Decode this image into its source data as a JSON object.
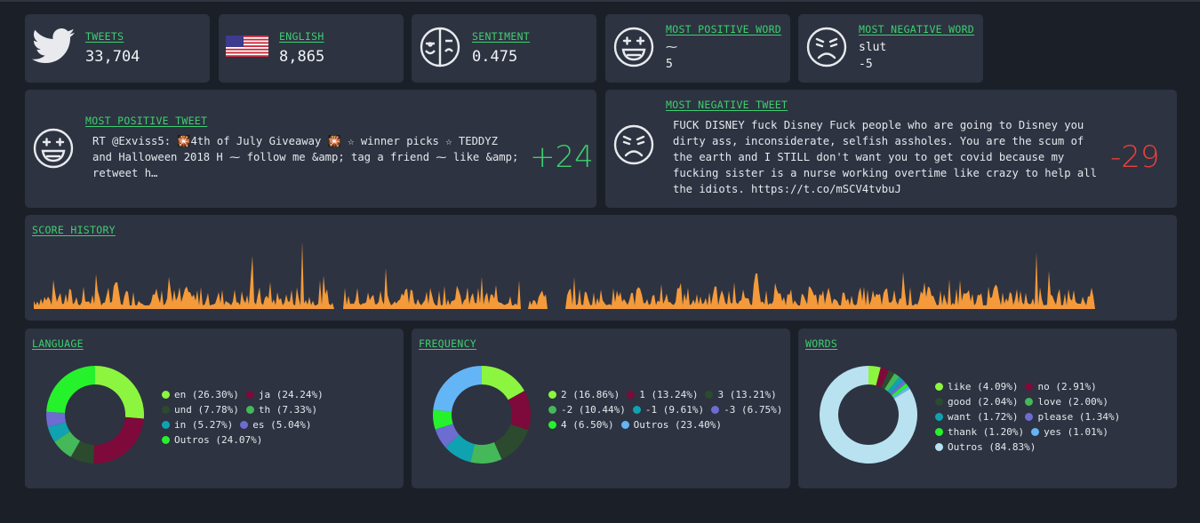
{
  "stats": {
    "tweets": {
      "label": "TWEETS",
      "value": "33,704"
    },
    "english": {
      "label": "ENGLISH",
      "value": "8,865"
    },
    "sentiment": {
      "label": "SENTIMENT",
      "value": "0.475"
    },
    "most_positive_word": {
      "label": "MOST POSITIVE WORD",
      "word": "⁓",
      "score": "5"
    },
    "most_negative_word": {
      "label": "MOST NEGATIVE WORD",
      "word": "slut",
      "score": "-5"
    }
  },
  "most_positive_tweet": {
    "label": "MOST POSITIVE TWEET",
    "lines": [
      "RT @Exviss5: 🎇4th of July Giveaway 🎇 ☆ winner picks ☆ TEDDYZ",
      "and Halloween 2018 H ⁓ follow me &amp; tag a friend ⁓ like &amp;",
      "retweet h…"
    ],
    "score": "+24",
    "score_color": "#3dcf6f"
  },
  "most_negative_tweet": {
    "label": "MOST NEGATIVE TWEET",
    "lines": [
      "FUCK DISNEY fuck Disney Fuck people who are going to Disney you",
      "dirty ass, inconsiderate, selfish assholes. You are the scum of",
      "the earth and I STILL don't want you to get covid because my",
      "fucking sister is a nurse working overtime like crazy to help all",
      "the idiots. https://t.co/mSCV4tvbuJ"
    ],
    "score": "-29",
    "score_color": "#e8413c"
  },
  "score_history": {
    "label": "SCORE HISTORY",
    "color": "#f59a3a"
  },
  "language": {
    "label": "LANGUAGE",
    "legend": [
      {
        "name": "en (26.30%)",
        "value": 26.3,
        "color": "#8cf53f"
      },
      {
        "name": "ja (24.24%)",
        "value": 24.24,
        "color": "#7d0a3a"
      },
      {
        "name": "und (7.78%)",
        "value": 7.78,
        "color": "#2c4a2e"
      },
      {
        "name": "th (7.33%)",
        "value": 7.33,
        "color": "#45b85a"
      },
      {
        "name": "in (5.27%)",
        "value": 5.27,
        "color": "#0fa3b1"
      },
      {
        "name": "es (5.04%)",
        "value": 5.04,
        "color": "#6c6cd1"
      },
      {
        "name": "Outros (24.07%)",
        "value": 24.07,
        "color": "#26f22c"
      }
    ]
  },
  "frequency": {
    "label": "FREQUENCY",
    "legend": [
      {
        "name": "2 (16.86%)",
        "value": 16.86,
        "color": "#8cf53f"
      },
      {
        "name": "1 (13.24%)",
        "value": 13.24,
        "color": "#7d0a3a"
      },
      {
        "name": "3 (13.21%)",
        "value": 13.21,
        "color": "#2c4a2e"
      },
      {
        "name": "-2 (10.44%)",
        "value": 10.44,
        "color": "#45b85a"
      },
      {
        "name": "-1 (9.61%)",
        "value": 9.61,
        "color": "#0fa3b1"
      },
      {
        "name": "-3 (6.75%)",
        "value": 6.75,
        "color": "#6c6cd1"
      },
      {
        "name": "4 (6.50%)",
        "value": 6.5,
        "color": "#26f22c"
      },
      {
        "name": "Outros (23.40%)",
        "value": 23.4,
        "color": "#64b5f6"
      }
    ]
  },
  "words": {
    "label": "WORDS",
    "legend": [
      {
        "name": "like (4.09%)",
        "value": 4.09,
        "color": "#8cf53f"
      },
      {
        "name": "no (2.91%)",
        "value": 2.91,
        "color": "#7d0a3a"
      },
      {
        "name": "good (2.04%)",
        "value": 2.04,
        "color": "#2c4a2e"
      },
      {
        "name": "love (2.00%)",
        "value": 2.0,
        "color": "#45b85a"
      },
      {
        "name": "want (1.72%)",
        "value": 1.72,
        "color": "#0fa3b1"
      },
      {
        "name": "please (1.34%)",
        "value": 1.34,
        "color": "#6c6cd1"
      },
      {
        "name": "thank (1.20%)",
        "value": 1.2,
        "color": "#26f22c"
      },
      {
        "name": "yes (1.01%)",
        "value": 1.01,
        "color": "#64b5f6"
      },
      {
        "name": "Outros (84.83%)",
        "value": 84.83,
        "color": "#b8e2f0"
      }
    ]
  }
}
